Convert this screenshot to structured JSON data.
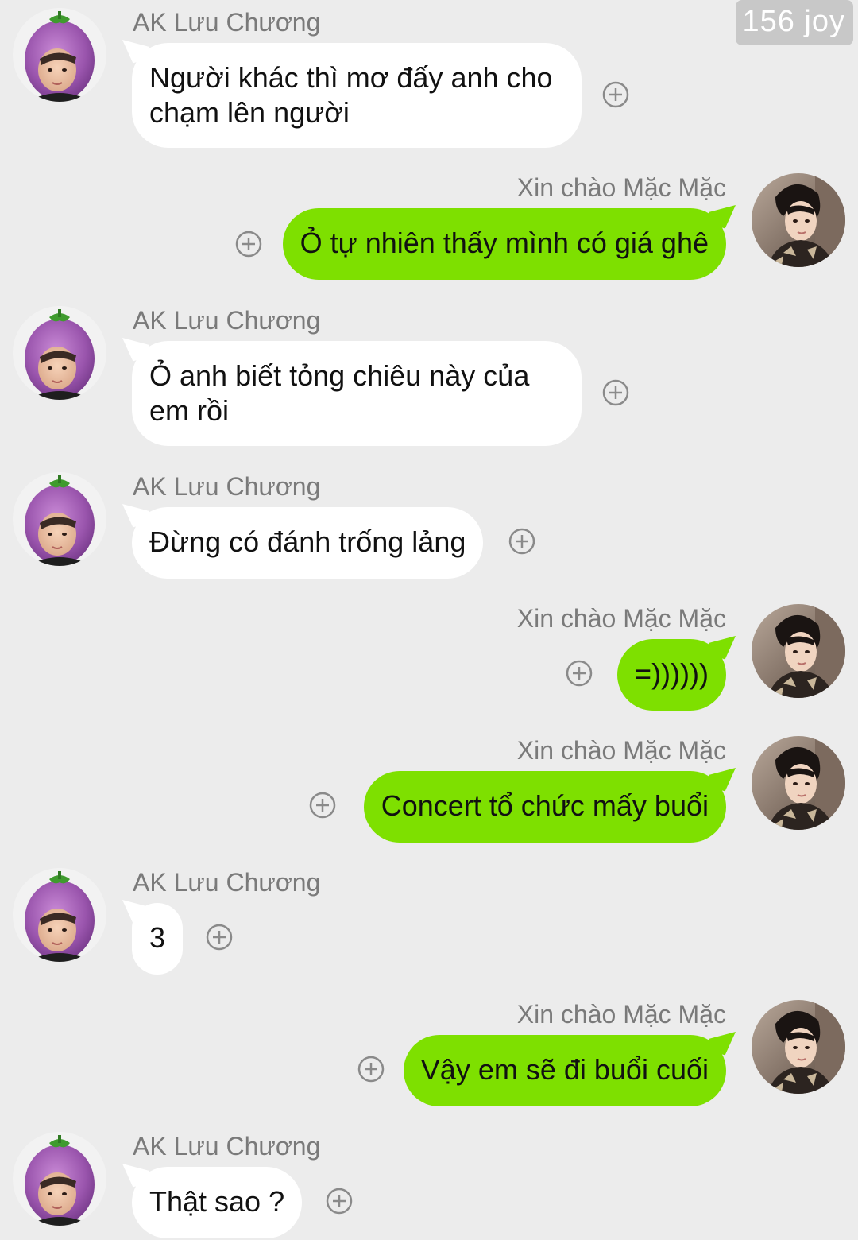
{
  "watermark": "156 joy",
  "contacts": {
    "other": "AK Lưu Chương",
    "me": "Xin chào Mặc Mặc"
  },
  "icons": {
    "add": "plus-circle-icon",
    "avatar_other": "eggplant-hat-avatar",
    "avatar_me": "profile-photo-avatar"
  },
  "colors": {
    "background": "#ececec",
    "incoming_bubble": "#ffffff",
    "outgoing_bubble": "#7ee000",
    "sender_name": "#7a7a7a"
  },
  "messages": [
    {
      "side": "left",
      "sender": "AK Lưu Chương",
      "text": "Người khác thì mơ đấy anh cho chạm lên người"
    },
    {
      "side": "right",
      "sender": "Xin chào Mặc Mặc",
      "text": "Ỏ tự nhiên thấy mình có giá ghê"
    },
    {
      "side": "left",
      "sender": "AK Lưu Chương",
      "text": "Ỏ anh biết tỏng chiêu này của em rồi"
    },
    {
      "side": "left",
      "sender": "AK Lưu Chương",
      "text": "Đừng có đánh trống lảng"
    },
    {
      "side": "right",
      "sender": "Xin chào Mặc Mặc",
      "text": "=))))))"
    },
    {
      "side": "right",
      "sender": "Xin chào Mặc Mặc",
      "text": "Concert tổ chức mấy buổi"
    },
    {
      "side": "left",
      "sender": "AK Lưu Chương",
      "text": "3"
    },
    {
      "side": "right",
      "sender": "Xin chào Mặc Mặc",
      "text": "Vậy em sẽ đi buổi cuối"
    },
    {
      "side": "left",
      "sender": "AK Lưu Chương",
      "text": "Thật sao ?"
    }
  ]
}
